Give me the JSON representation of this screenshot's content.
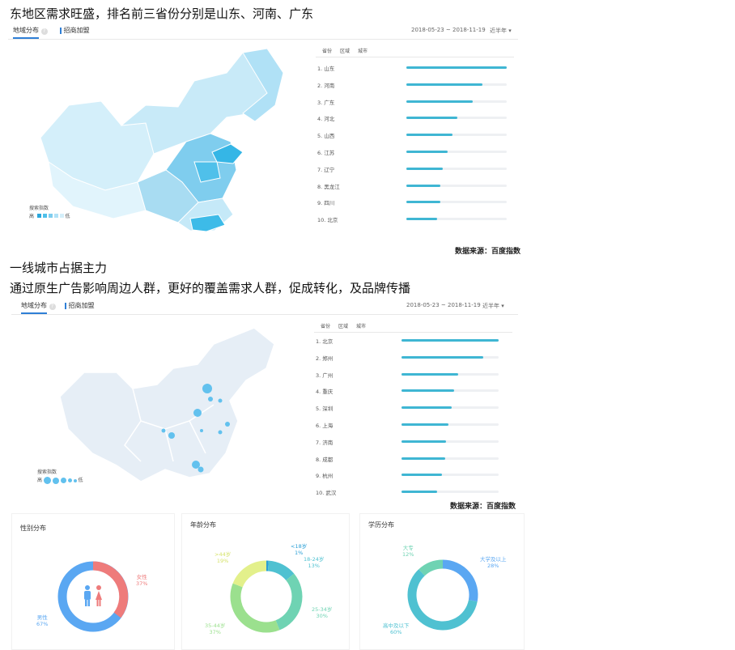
{
  "section1": {
    "heading": "东地区需求旺盛，排名前三省份分别是山东、河南、广东",
    "tabs": [
      {
        "label": "地域分布"
      },
      {
        "label": "招商加盟"
      }
    ],
    "date_range": "2018-05-23 ~ 2018-11-19",
    "period": "近半年",
    "columns": [
      "省份",
      "区域",
      "城市"
    ],
    "legend_title": "搜索指数",
    "legend_high": "高",
    "legend_low": "低",
    "ranking": [
      {
        "label": "1.  山东",
        "value": 1.0
      },
      {
        "label": "2.  河南",
        "value": 0.76
      },
      {
        "label": "3.  广东",
        "value": 0.66
      },
      {
        "label": "4.  河北",
        "value": 0.51
      },
      {
        "label": "5.  山西",
        "value": 0.46
      },
      {
        "label": "6.  江苏",
        "value": 0.41
      },
      {
        "label": "7.  辽宁",
        "value": 0.36
      },
      {
        "label": "8.  黑龙江",
        "value": 0.34
      },
      {
        "label": "9.  四川",
        "value": 0.34
      },
      {
        "label": "10. 北京",
        "value": 0.31
      }
    ],
    "source": "数据来源：百度指数"
  },
  "section2": {
    "heading1": "一线城市占据主力",
    "heading2": "通过原生广告影响周边人群，更好的覆盖需求人群，促成转化，及品牌传播",
    "tabs": [
      {
        "label": "地域分布"
      },
      {
        "label": "招商加盟"
      }
    ],
    "date_range": "2018-05-23 ~ 2018-11-19",
    "period": "近半年",
    "columns": [
      "省份",
      "区域",
      "城市"
    ],
    "legend_title": "搜索指数",
    "legend_high": "高",
    "legend_low": "低",
    "ranking": [
      {
        "label": "1.  北京",
        "value": 1.0
      },
      {
        "label": "2.  郑州",
        "value": 0.84
      },
      {
        "label": "3.  广州",
        "value": 0.58
      },
      {
        "label": "4.  重庆",
        "value": 0.54
      },
      {
        "label": "5.  深圳",
        "value": 0.52
      },
      {
        "label": "6.  上海",
        "value": 0.48
      },
      {
        "label": "7.  济南",
        "value": 0.46
      },
      {
        "label": "8.  成都",
        "value": 0.45
      },
      {
        "label": "9.  杭州",
        "value": 0.42
      },
      {
        "label": "10. 武汉",
        "value": 0.37
      }
    ],
    "source": "数据来源：百度指数"
  },
  "cards": {
    "gender": {
      "title": "性别分布",
      "female_label": "女性",
      "female_pct": "37%",
      "male_label": "男性",
      "male_pct": "67%",
      "female_color": "#ee7b7b",
      "male_color": "#5aa7f2"
    },
    "age": {
      "title": "年龄分布",
      "segments": [
        {
          "label": "<18岁",
          "pct": "1%",
          "value": 1,
          "color": "#2a9fd6"
        },
        {
          "label": "18-24岁",
          "pct": "13%",
          "value": 13,
          "color": "#4fc1d1"
        },
        {
          "label": "25-34岁",
          "pct": "30%",
          "value": 30,
          "color": "#6fd3b3"
        },
        {
          "label": "35-44岁",
          "pct": "37%",
          "value": 37,
          "color": "#9be08e"
        },
        {
          "label": ">44岁",
          "pct": "19%",
          "value": 19,
          "color": "#e3f08b"
        }
      ]
    },
    "education": {
      "title": "学历分布",
      "segments": [
        {
          "label": "大学及以上",
          "pct": "28%",
          "value": 28,
          "color": "#5aa7f2"
        },
        {
          "label": "高中及以下",
          "pct": "60%",
          "value": 60,
          "color": "#4fc1d1"
        },
        {
          "label": "大专",
          "pct": "12%",
          "value": 12,
          "color": "#6fd3b3"
        }
      ]
    }
  }
}
